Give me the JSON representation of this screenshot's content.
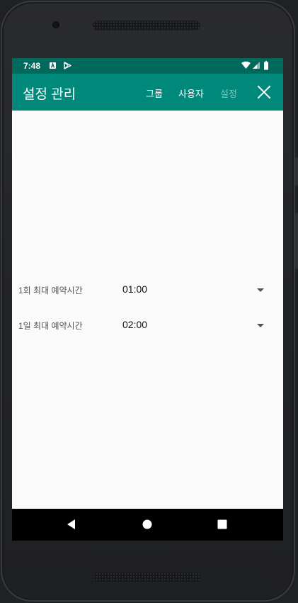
{
  "status_bar": {
    "time": "7:48"
  },
  "app_bar": {
    "title": "설정 관리",
    "actions": [
      {
        "label": "그룹",
        "enabled": true
      },
      {
        "label": "사용자",
        "enabled": true
      },
      {
        "label": "설정",
        "enabled": false
      }
    ]
  },
  "settings": [
    {
      "label": "1회 최대 예약시간",
      "value": "01:00"
    },
    {
      "label": "1일 최대 예약시간",
      "value": "02:00"
    }
  ],
  "colors": {
    "status_bar": "#00695c",
    "app_bar": "#00897b",
    "background": "#fafafa"
  },
  "icons": {
    "status_left": [
      "a-notification-icon",
      "play-store-icon"
    ],
    "status_right": [
      "wifi-icon",
      "cell-signal-icon",
      "battery-icon"
    ],
    "app_bar": [
      "close-icon"
    ],
    "nav": [
      "back-icon",
      "home-icon",
      "recents-icon"
    ]
  }
}
